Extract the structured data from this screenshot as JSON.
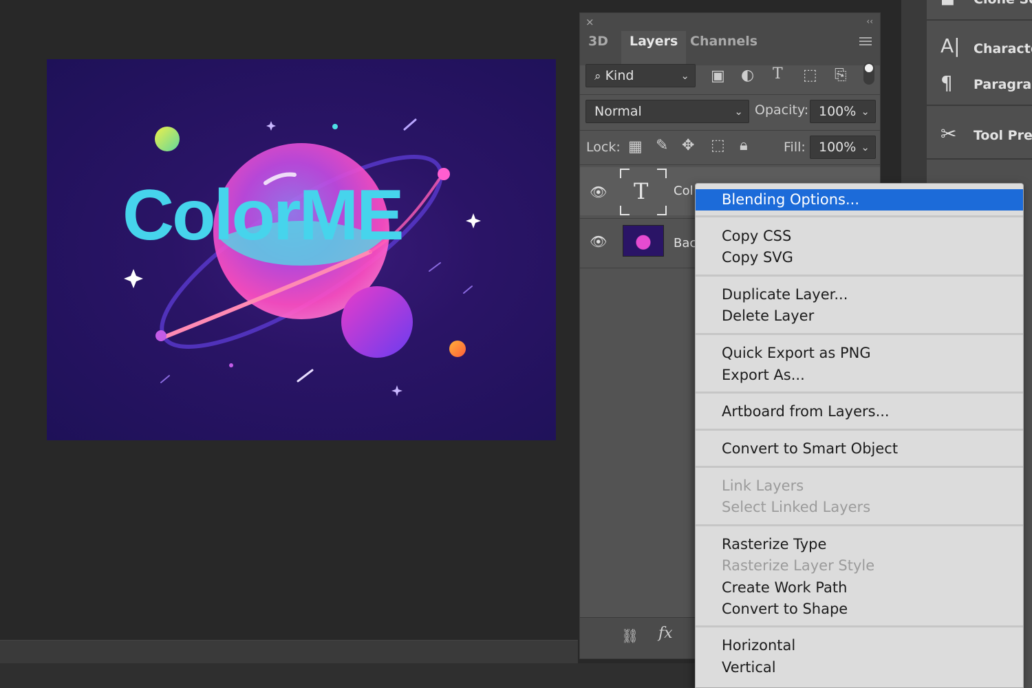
{
  "artwork": {
    "title_text": "ColorME"
  },
  "layers_panel": {
    "close_glyph": "×",
    "collapse_glyph": "‹‹",
    "tabs": [
      {
        "label": "3D",
        "active": false
      },
      {
        "label": "Layers",
        "active": true
      },
      {
        "label": "Channels",
        "active": false
      }
    ],
    "filter": {
      "label": "Kind"
    },
    "blend_mode": "Normal",
    "opacity_label": "Opacity:",
    "opacity_value": "100%",
    "lock_label": "Lock:",
    "fill_label": "Fill:",
    "fill_value": "100%",
    "layers": [
      {
        "name": "Col",
        "type": "text",
        "visible": true
      },
      {
        "name": "Bac",
        "type": "image",
        "visible": true
      }
    ],
    "footer_icons": [
      "link-icon",
      "fx-icon"
    ]
  },
  "right_dock": {
    "items": [
      {
        "label": "Clone So",
        "icon": "clone-source-icon"
      },
      {
        "label": "Characte",
        "icon": "character-icon"
      },
      {
        "label": "Paragrap",
        "icon": "paragraph-icon"
      },
      {
        "label": "Tool Pres",
        "icon": "tool-presets-icon"
      }
    ]
  },
  "context_menu": {
    "groups": [
      [
        {
          "label": "Blending Options...",
          "enabled": true,
          "highlighted": true
        }
      ],
      [
        {
          "label": "Copy CSS",
          "enabled": true
        },
        {
          "label": "Copy SVG",
          "enabled": true
        }
      ],
      [
        {
          "label": "Duplicate Layer...",
          "enabled": true
        },
        {
          "label": "Delete Layer",
          "enabled": true
        }
      ],
      [
        {
          "label": "Quick Export as PNG",
          "enabled": true
        },
        {
          "label": "Export As...",
          "enabled": true
        }
      ],
      [
        {
          "label": "Artboard from Layers...",
          "enabled": true
        }
      ],
      [
        {
          "label": "Convert to Smart Object",
          "enabled": true
        }
      ],
      [
        {
          "label": "Link Layers",
          "enabled": false
        },
        {
          "label": "Select Linked Layers",
          "enabled": false
        }
      ],
      [
        {
          "label": "Rasterize Type",
          "enabled": true
        },
        {
          "label": "Rasterize Layer Style",
          "enabled": false
        },
        {
          "label": "Create Work Path",
          "enabled": true
        },
        {
          "label": "Convert to Shape",
          "enabled": true
        }
      ],
      [
        {
          "label": "Horizontal",
          "enabled": true
        },
        {
          "label": "Vertical",
          "enabled": true
        }
      ]
    ],
    "highlight_color": "#1c6bd9"
  }
}
